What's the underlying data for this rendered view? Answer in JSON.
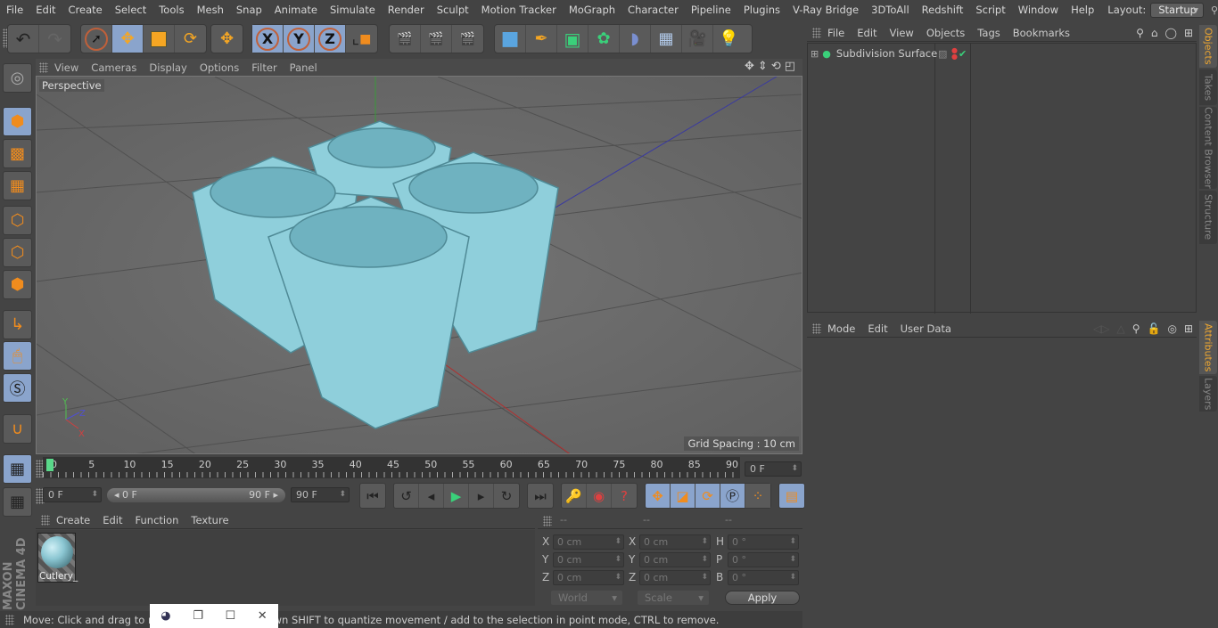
{
  "menubar": {
    "items": [
      "File",
      "Edit",
      "Create",
      "Select",
      "Tools",
      "Mesh",
      "Snap",
      "Animate",
      "Simulate",
      "Render",
      "Sculpt",
      "Motion Tracker",
      "MoGraph",
      "Character",
      "Pipeline",
      "Plugins",
      "V-Ray Bridge",
      "3DToAll",
      "Redshift",
      "Script",
      "Window",
      "Help"
    ],
    "layout_label": "Layout:",
    "layout_value": "Startup"
  },
  "toolbar": {
    "undo": "undo-icon",
    "redo": "redo-icon",
    "axis_x": "X",
    "axis_y": "Y",
    "axis_z": "Z"
  },
  "viewport": {
    "menu": [
      "View",
      "Cameras",
      "Display",
      "Options",
      "Filter",
      "Panel"
    ],
    "camera_label": "Perspective",
    "grid_spacing": "Grid Spacing : 10 cm",
    "axis_labels": {
      "x": "X",
      "y": "Y",
      "z": "Z"
    }
  },
  "timeline": {
    "ticks": [
      "0",
      "5",
      "10",
      "15",
      "20",
      "25",
      "30",
      "35",
      "40",
      "45",
      "50",
      "55",
      "60",
      "65",
      "70",
      "75",
      "80",
      "85",
      "90"
    ],
    "current_frame": "0 F",
    "start_field": "0 F",
    "range_start": "0 F",
    "range_end": "90 F",
    "end_field": "90 F"
  },
  "material_manager": {
    "menu": [
      "Create",
      "Edit",
      "Function",
      "Texture"
    ],
    "materials": [
      {
        "name": "Cutlery_"
      }
    ]
  },
  "coordinates": {
    "headers": [
      "--",
      "--",
      "--"
    ],
    "position": [
      {
        "label": "X",
        "value": "0 cm"
      },
      {
        "label": "Y",
        "value": "0 cm"
      },
      {
        "label": "Z",
        "value": "0 cm"
      }
    ],
    "size": [
      {
        "label": "X",
        "value": "0 cm"
      },
      {
        "label": "Y",
        "value": "0 cm"
      },
      {
        "label": "Z",
        "value": "0 cm"
      }
    ],
    "rotation": [
      {
        "label": "H",
        "value": "0 °"
      },
      {
        "label": "P",
        "value": "0 °"
      },
      {
        "label": "B",
        "value": "0 °"
      }
    ],
    "space_dropdown": "World",
    "mode_dropdown": "Scale",
    "apply_label": "Apply"
  },
  "objects_panel": {
    "menu": [
      "File",
      "Edit",
      "View",
      "Objects",
      "Tags",
      "Bookmarks"
    ],
    "items": [
      {
        "name": "Subdivision Surface"
      }
    ]
  },
  "attributes_panel": {
    "menu": [
      "Mode",
      "Edit",
      "User Data"
    ]
  },
  "side_tabs": {
    "top": [
      "Objects",
      "Takes",
      "Content Browser",
      "Structure"
    ],
    "bottom": [
      "Attributes",
      "Layers"
    ]
  },
  "branding": "MAXON CINEMA 4D",
  "statusbar": {
    "text": "Move: Click and drag to move elements. Hold down SHIFT to quantize movement / add to the selection in point mode, CTRL to remove.",
    "visible_left": "Move: Click and drag to mo",
    "visible_right": "FT to quantize movement / add to the selection in point mode, CTRL to remove."
  },
  "colors": {
    "accent_orange": "#f0a830",
    "selected_blue": "#8aa4cc",
    "model_color": "#8fd0dc",
    "keyframe_green": "#5ad88a"
  }
}
